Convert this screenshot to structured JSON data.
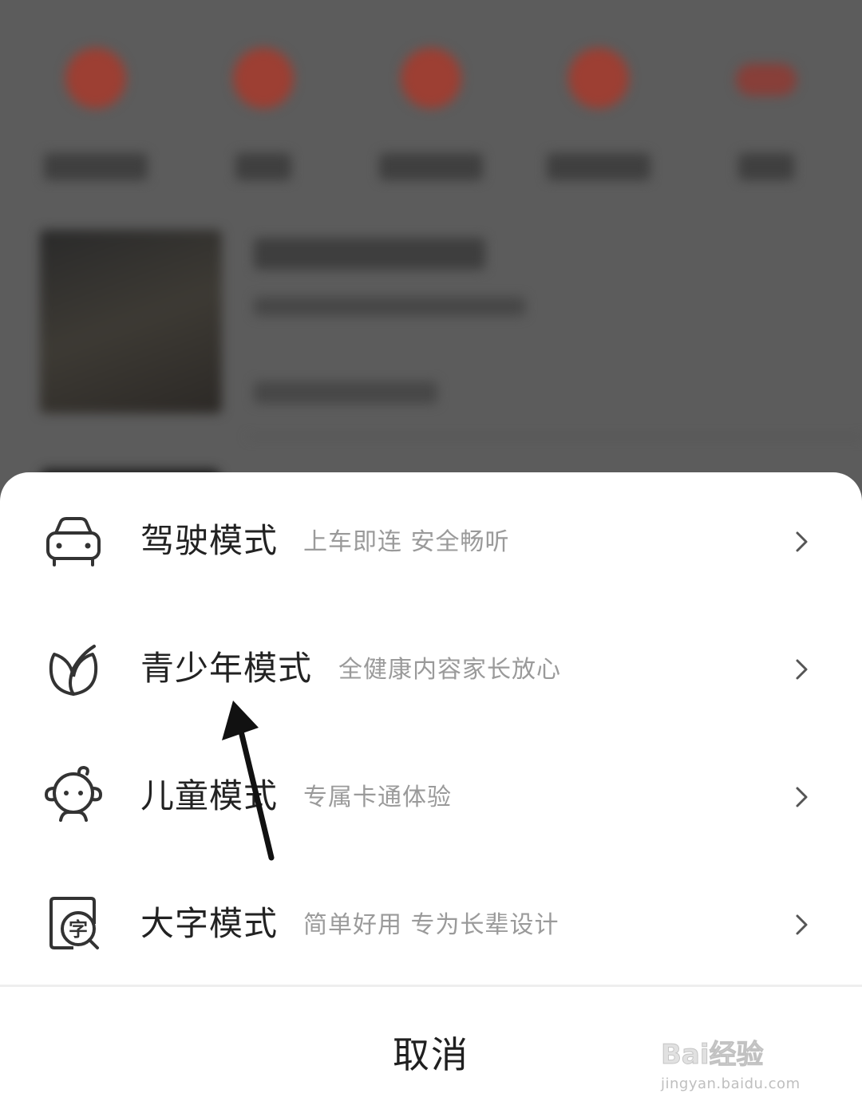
{
  "background": {
    "shortcut_colors": [
      "#b23a2a",
      "#b23a2a",
      "#b23a2a",
      "#b23a2a",
      "#9a3a30"
    ],
    "shortcut_icons": [
      "app-shortcut-icon",
      "app-shortcut-icon",
      "app-shortcut-icon",
      "app-shortcut-icon",
      "app-shortcut-icon"
    ]
  },
  "sheet": {
    "modes": [
      {
        "title": "驾驶模式",
        "subtitle": "上车即连  安全畅听",
        "icon": "car-icon"
      },
      {
        "title": "青少年模式",
        "subtitle": "全健康内容家长放心",
        "icon": "leaf-icon"
      },
      {
        "title": "儿童模式",
        "subtitle": "专属卡通体验",
        "icon": "child-face-icon"
      },
      {
        "title": "大字模式",
        "subtitle": "简单好用  专为长辈设计",
        "icon": "large-text-icon"
      }
    ],
    "cancel_label": "取消"
  },
  "watermark": {
    "brand": "Bai经验",
    "url": "jingyan.baidu.com"
  },
  "colors": {
    "title_text": "#222222",
    "subtitle_text": "#9a9a9a",
    "sheet_bg": "#ffffff",
    "overlay_bg": "#5c5c5c"
  }
}
